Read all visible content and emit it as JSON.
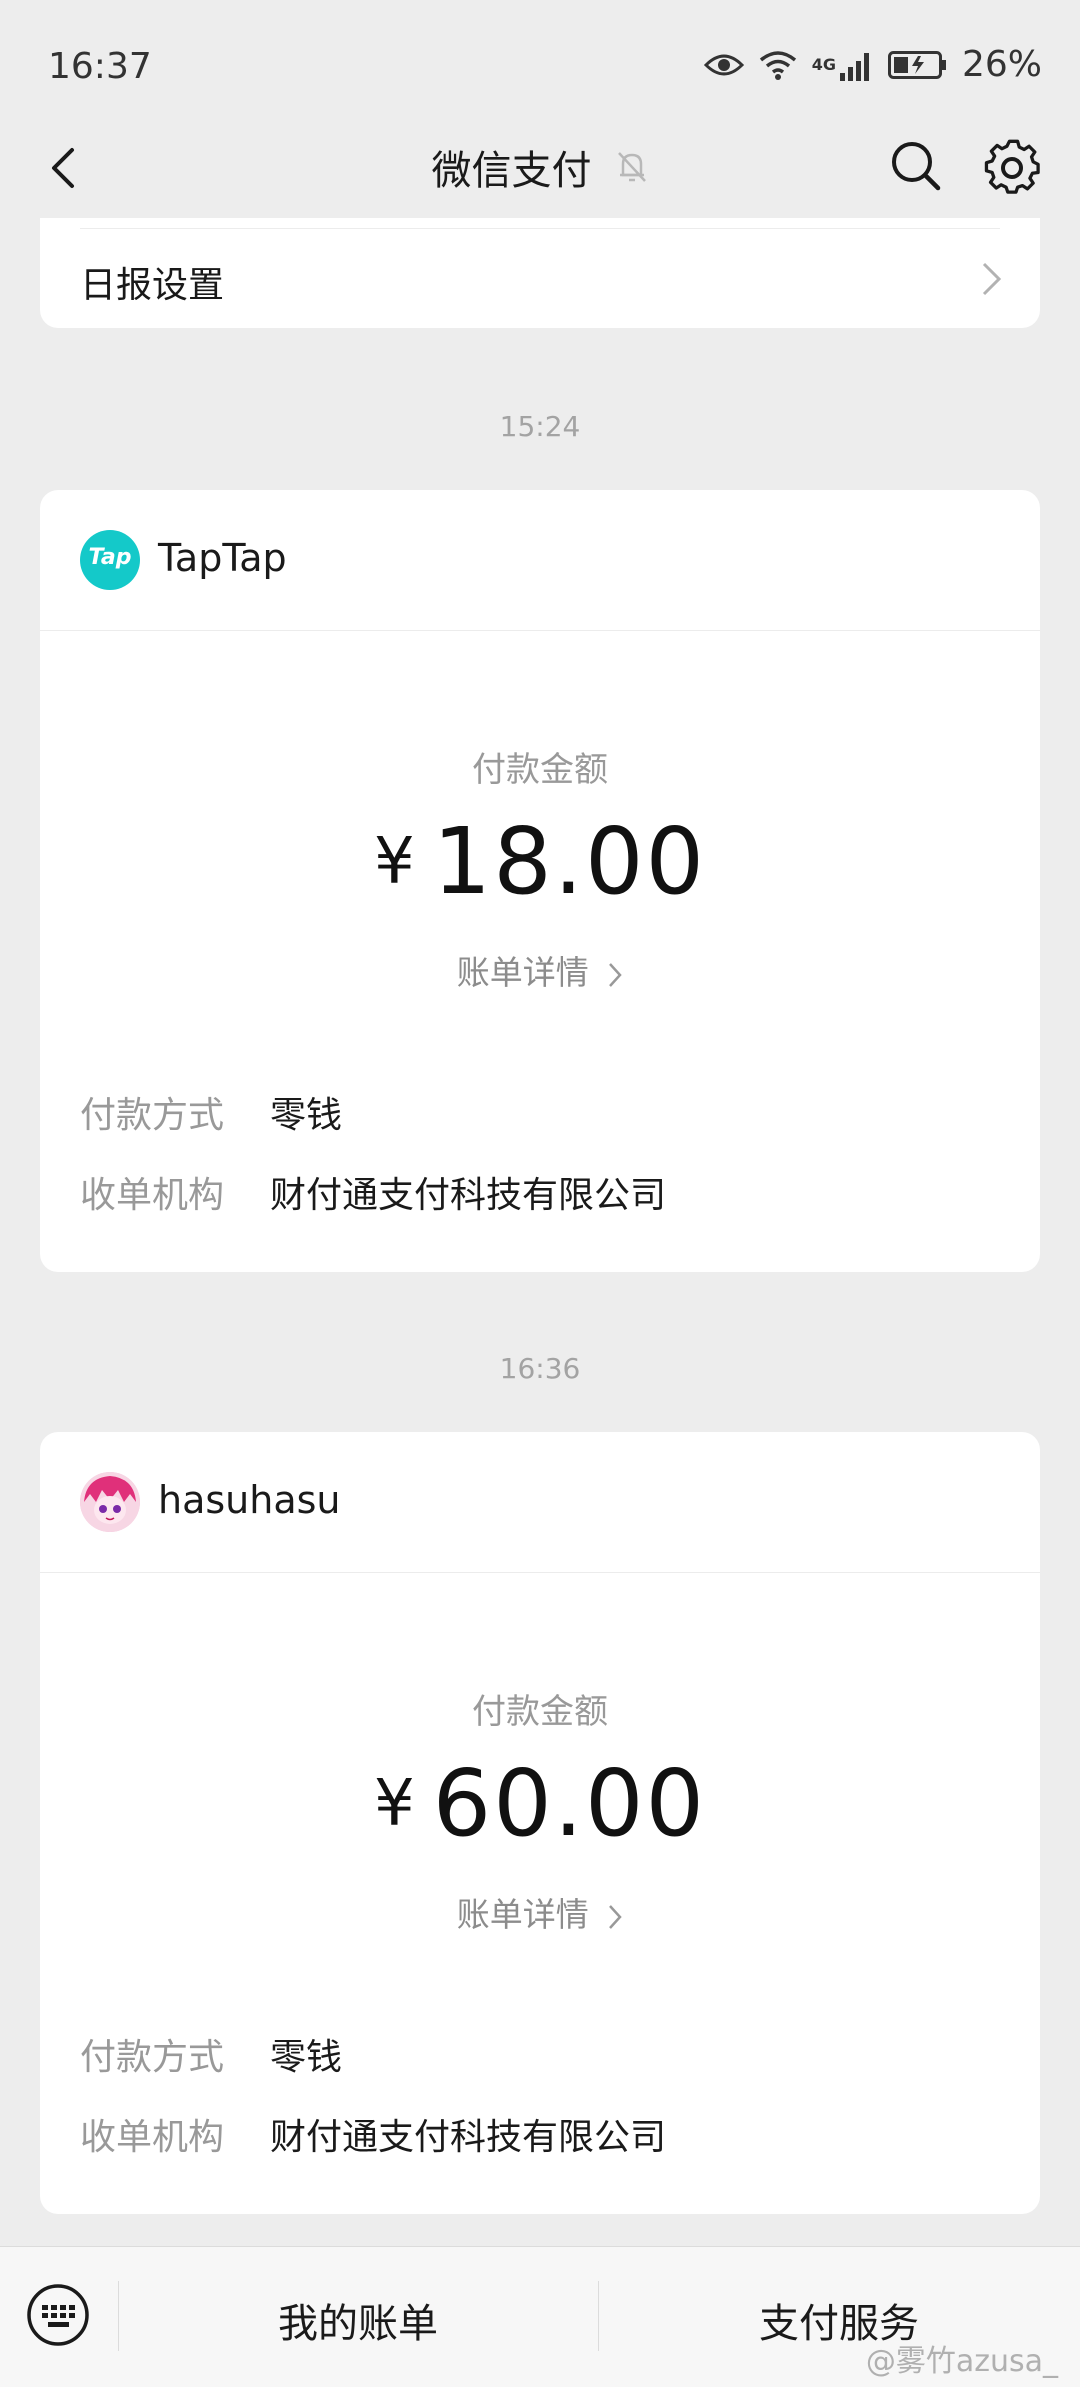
{
  "status_bar": {
    "time": "16:37",
    "network": "4G",
    "battery_percent": "26%",
    "icons": [
      "eye-icon",
      "wifi-icon",
      "signal-icon",
      "battery-icon"
    ]
  },
  "navbar": {
    "title": "微信支付",
    "icons": [
      "back-icon",
      "mute-bell-icon",
      "search-icon",
      "gear-icon"
    ]
  },
  "settings_row": {
    "label": "日报设置"
  },
  "messages": [
    {
      "time": "15:24",
      "merchant": "TapTap",
      "logo_text": "Tap",
      "logo_color": "#14c9c9",
      "amount_label": "付款金额",
      "currency": "¥",
      "amount": "18.00",
      "detail_link": "账单详情",
      "payment_method_label": "付款方式",
      "payment_method": "零钱",
      "acquirer_label": "收单机构",
      "acquirer": "财付通支付科技有限公司"
    },
    {
      "time": "16:36",
      "merchant": "hasuhasu",
      "logo_color": "#e0307a",
      "amount_label": "付款金额",
      "currency": "¥",
      "amount": "60.00",
      "detail_link": "账单详情",
      "payment_method_label": "付款方式",
      "payment_method": "零钱",
      "acquirer_label": "收单机构",
      "acquirer": "财付通支付科技有限公司"
    }
  ],
  "bottom_bar": {
    "my_bills": "我的账单",
    "pay_services": "支付服务"
  },
  "watermark": "@雾竹azusa_"
}
